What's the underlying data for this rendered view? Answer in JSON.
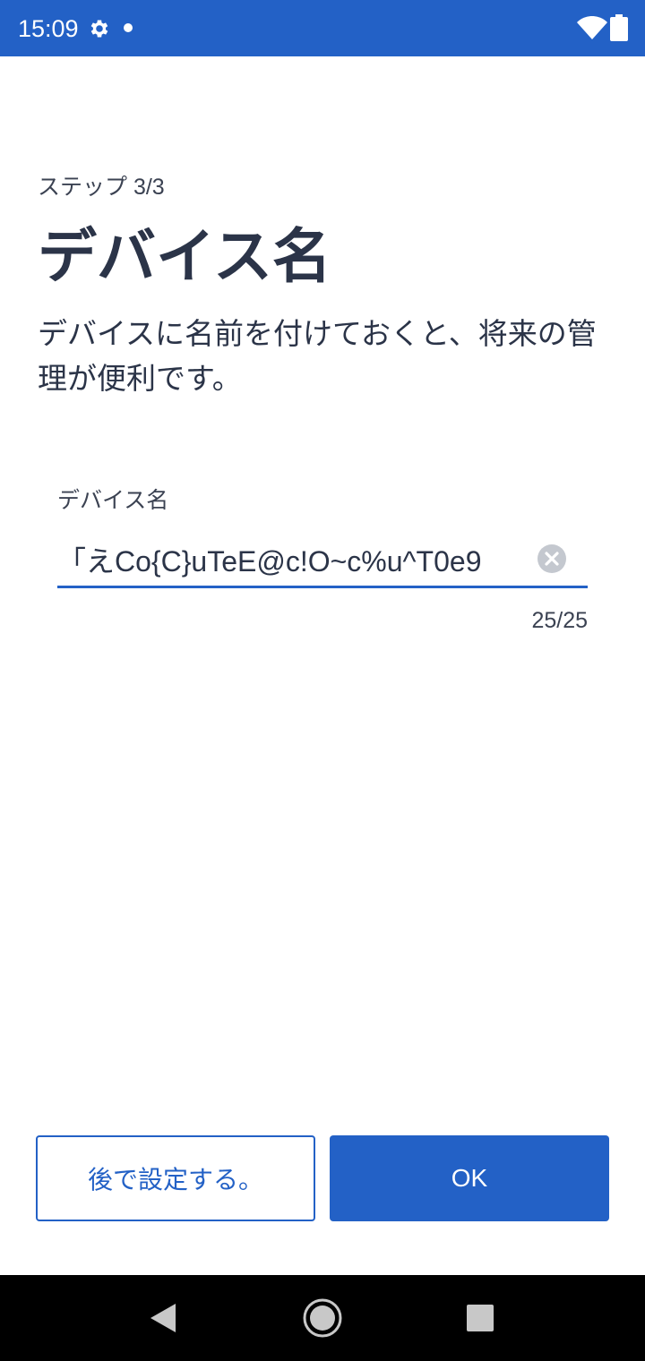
{
  "status_bar": {
    "time": "15:09",
    "icons": [
      "gear-icon",
      "notification-dot-icon",
      "wifi-icon",
      "battery-icon"
    ],
    "background": "#2361c6"
  },
  "content": {
    "step": "ステップ 3/3",
    "title": "デバイス名",
    "description": "デバイスに名前を付けておくと、将来の管理が便利です。"
  },
  "device_name_field": {
    "label": "デバイス名",
    "value": "「えCo{C}uTeE@c!O~c%u^T0e9",
    "counter": "25/25",
    "clear_icon": "clear-circle-icon"
  },
  "actions": {
    "later_label": "後で設定する。",
    "ok_label": "OK"
  },
  "nav_bar": {
    "icons": [
      "back-icon",
      "home-icon",
      "recents-icon"
    ]
  },
  "colors": {
    "accent": "#2361c6",
    "text": "#2b3448",
    "clear_icon": "#c4c8cf"
  }
}
